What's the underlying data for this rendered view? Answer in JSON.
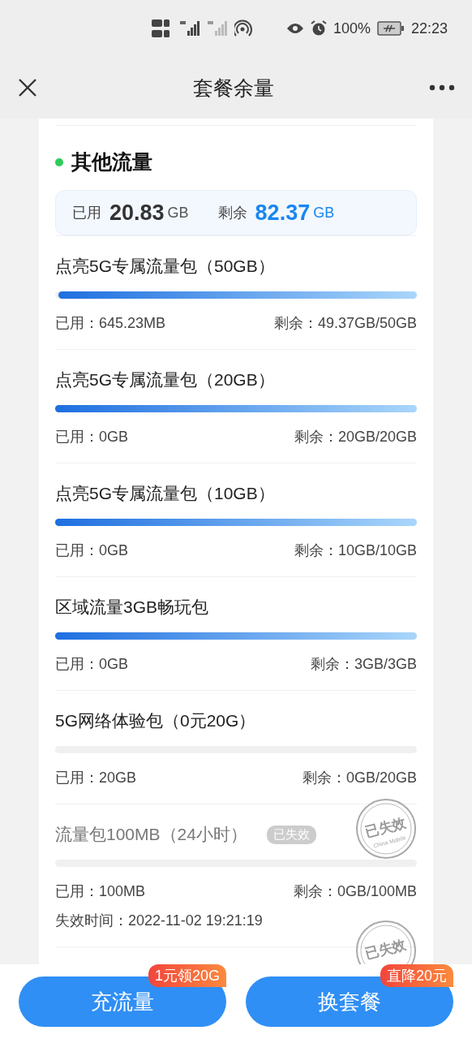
{
  "status_bar": {
    "battery": "100%",
    "time": "22:23"
  },
  "header": {
    "title": "套餐余量"
  },
  "section": {
    "title": "其他流量",
    "used_label": "已用",
    "used_value": "20.83",
    "used_unit": "GB",
    "left_label": "剩余",
    "left_value": "82.37",
    "left_unit": "GB"
  },
  "packages": [
    {
      "name": "点亮5G专属流量包（50GB）",
      "level": 0.99,
      "used": "已用：645.23MB",
      "remaining": "剩余：49.37GB/50GB",
      "expired": false
    },
    {
      "name": "点亮5G专属流量包（20GB）",
      "level": 1,
      "used": "已用：0GB",
      "remaining": "剩余：20GB/20GB",
      "expired": false
    },
    {
      "name": "点亮5G专属流量包（10GB）",
      "level": 1,
      "used": "已用：0GB",
      "remaining": "剩余：10GB/10GB",
      "expired": false
    },
    {
      "name": "区域流量3GB畅玩包",
      "level": 1,
      "used": "已用：0GB",
      "remaining": "剩余：3GB/3GB",
      "expired": false
    },
    {
      "name": "5G网络体验包（0元20G）",
      "level": 0,
      "used": "已用：20GB",
      "remaining": "剩余：0GB/20GB",
      "expired": false
    },
    {
      "name": "流量包100MB（24小时）",
      "level": 0,
      "used": "已用：100MB",
      "remaining": "剩余：0GB/100MB",
      "expired": true,
      "tag": "已失效",
      "stamp": "已失效",
      "stamp_caption": "China Mobile",
      "expire_time": "失效时间：2022-11-02 19:21:19"
    }
  ],
  "cut_item": {
    "stamp": "已失效"
  },
  "actions": [
    {
      "label": "充流量",
      "badge": "1元领20G"
    },
    {
      "label": "换套餐",
      "badge": "直降20元"
    }
  ]
}
